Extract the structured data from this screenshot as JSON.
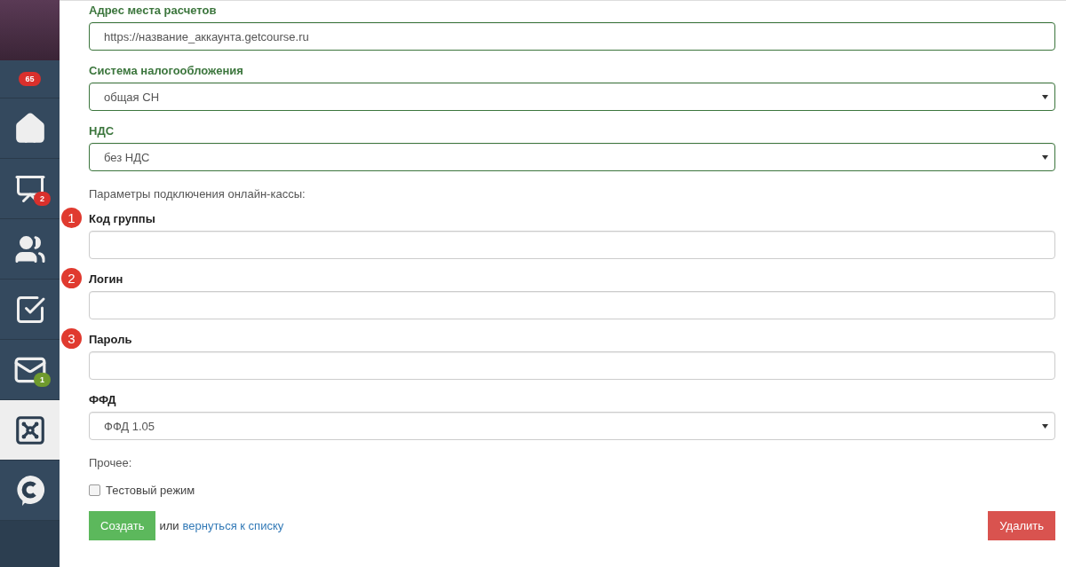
{
  "sidebar": {
    "avatar_badge": {
      "text": "65",
      "color": "#d9302c"
    },
    "items": [
      {
        "selected": false
      },
      {
        "selected": false,
        "badge": {
          "text": "2",
          "color": "#d9302c"
        }
      },
      {
        "selected": false
      },
      {
        "selected": false
      },
      {
        "selected": false,
        "badge": {
          "text": "1",
          "color": "#6f9a2d"
        }
      },
      {
        "selected": true
      },
      {
        "selected": false
      }
    ]
  },
  "form": [
    {
      "kind": "input",
      "label": "Адрес места расчетов",
      "value": "https://название_аккаунта.getcourse.ru",
      "valid": true
    },
    {
      "kind": "select",
      "label": "Система налогообложения",
      "value": "общая СН",
      "valid": true
    },
    {
      "kind": "select",
      "label": "НДС",
      "value": "без НДС",
      "valid": true
    },
    {
      "kind": "section",
      "text": "Параметры подключения онлайн-кассы:"
    },
    {
      "kind": "input",
      "marker": "1",
      "label": "Код группы",
      "valid": false
    },
    {
      "kind": "input",
      "marker": "2",
      "label": "Логин",
      "valid": false
    },
    {
      "kind": "input",
      "marker": "3",
      "label": "Пароль",
      "valid": false
    },
    {
      "kind": "select",
      "label": "ФФД",
      "value": "ФФД 1.05",
      "valid": false
    },
    {
      "kind": "section",
      "text": "Прочее:"
    },
    {
      "kind": "checkbox",
      "label": "Тестовый режим",
      "checked": false
    }
  ],
  "actions": {
    "create": "Создать",
    "or": "или",
    "back_link": "вернуться к списку",
    "delete": "Удалить"
  }
}
